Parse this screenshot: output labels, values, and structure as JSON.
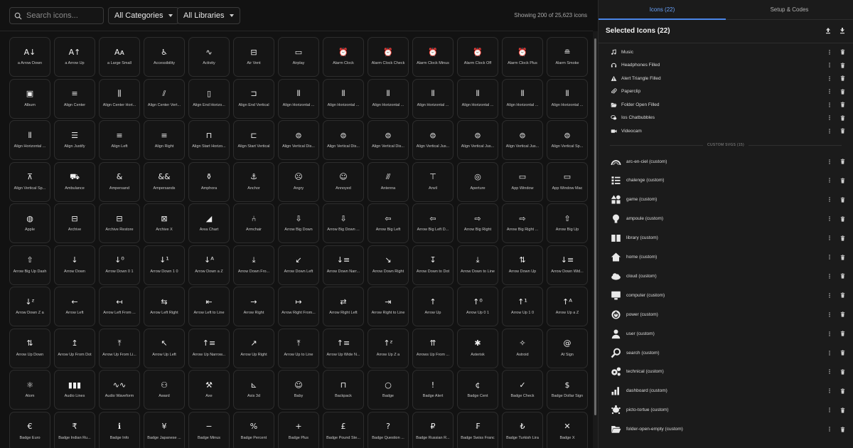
{
  "toolbar": {
    "search_placeholder": "Search icons...",
    "category_select": "All Categories",
    "library_select": "All Libraries",
    "count_text": "Showing 200 of 25,623 icons"
  },
  "icons": [
    {
      "label": "a Arrow Down",
      "glyph": "A↓"
    },
    {
      "label": "a Arrow Up",
      "glyph": "A↑"
    },
    {
      "label": "a Large Small",
      "glyph": "Aᴀ"
    },
    {
      "label": "Accessibility",
      "glyph": "♿"
    },
    {
      "label": "Activity",
      "glyph": "∿"
    },
    {
      "label": "Air Vent",
      "glyph": "⊟"
    },
    {
      "label": "Airplay",
      "glyph": "▭"
    },
    {
      "label": "Alarm Clock",
      "glyph": "⏰"
    },
    {
      "label": "Alarm Clock Check",
      "glyph": "⏰"
    },
    {
      "label": "Alarm Clock Minus",
      "glyph": "⏰"
    },
    {
      "label": "Alarm Clock Off",
      "glyph": "⏰"
    },
    {
      "label": "Alarm Clock Plus",
      "glyph": "⏰"
    },
    {
      "label": "Alarm Smoke",
      "glyph": "≘"
    },
    {
      "label": "Album",
      "glyph": "▣"
    },
    {
      "label": "Align Center",
      "glyph": "≡"
    },
    {
      "label": "Align Center Hori...",
      "glyph": "⫼"
    },
    {
      "label": "Align Center Vert...",
      "glyph": "⫽"
    },
    {
      "label": "Align End Horizo...",
      "glyph": "▯"
    },
    {
      "label": "Align End Vertical",
      "glyph": "⊐"
    },
    {
      "label": "Align Horizontal ...",
      "glyph": "⫴"
    },
    {
      "label": "Align Horizontal ...",
      "glyph": "⫴"
    },
    {
      "label": "Align Horizontal ...",
      "glyph": "⫴"
    },
    {
      "label": "Align Horizontal ...",
      "glyph": "⫴"
    },
    {
      "label": "Align Horizontal ...",
      "glyph": "⫴"
    },
    {
      "label": "Align Horizontal ...",
      "glyph": "⫴"
    },
    {
      "label": "Align Horizontal ...",
      "glyph": "⫴"
    },
    {
      "label": "Align Horizontal ...",
      "glyph": "⫴"
    },
    {
      "label": "Align Justify",
      "glyph": "☰"
    },
    {
      "label": "Align Left",
      "glyph": "≡"
    },
    {
      "label": "Align Right",
      "glyph": "≡"
    },
    {
      "label": "Align Start Horizo...",
      "glyph": "⊓"
    },
    {
      "label": "Align Start Vertical",
      "glyph": "⊏"
    },
    {
      "label": "Align Vertical Dis...",
      "glyph": "⊜"
    },
    {
      "label": "Align Vertical Dis...",
      "glyph": "⊜"
    },
    {
      "label": "Align Vertical Dis...",
      "glyph": "⊜"
    },
    {
      "label": "Align Vertical Jus...",
      "glyph": "⊜"
    },
    {
      "label": "Align Vertical Jus...",
      "glyph": "⊜"
    },
    {
      "label": "Align Vertical Jus...",
      "glyph": "⊜"
    },
    {
      "label": "Align Vertical Sp...",
      "glyph": "⊜"
    },
    {
      "label": "Align Vertical Sp...",
      "glyph": "⊼"
    },
    {
      "label": "Ambulance",
      "glyph": "⛟"
    },
    {
      "label": "Ampersand",
      "glyph": "&"
    },
    {
      "label": "Ampersands",
      "glyph": "&&"
    },
    {
      "label": "Amphora",
      "glyph": "⚱"
    },
    {
      "label": "Anchor",
      "glyph": "⚓"
    },
    {
      "label": "Angry",
      "glyph": "☹"
    },
    {
      "label": "Annoyed",
      "glyph": "☺"
    },
    {
      "label": "Antenna",
      "glyph": "⫻"
    },
    {
      "label": "Anvil",
      "glyph": "⊤"
    },
    {
      "label": "Aperture",
      "glyph": "◎"
    },
    {
      "label": "App Window",
      "glyph": "▭"
    },
    {
      "label": "App Window Mac",
      "glyph": "▭"
    },
    {
      "label": "Apple",
      "glyph": "◍"
    },
    {
      "label": "Archive",
      "glyph": "⊟"
    },
    {
      "label": "Archive Restore",
      "glyph": "⊟"
    },
    {
      "label": "Archive X",
      "glyph": "⊠"
    },
    {
      "label": "Area Chart",
      "glyph": "◢"
    },
    {
      "label": "Armchair",
      "glyph": "⑃"
    },
    {
      "label": "Arrow Big Down",
      "glyph": "⇩"
    },
    {
      "label": "Arrow Big Down ...",
      "glyph": "⇩"
    },
    {
      "label": "Arrow Big Left",
      "glyph": "⇦"
    },
    {
      "label": "Arrow Big Left D...",
      "glyph": "⇦"
    },
    {
      "label": "Arrow Big Right",
      "glyph": "⇨"
    },
    {
      "label": "Arrow Big Right ...",
      "glyph": "⇨"
    },
    {
      "label": "Arrow Big Up",
      "glyph": "⇧"
    },
    {
      "label": "Arrow Big Up Dash",
      "glyph": "⇧"
    },
    {
      "label": "Arrow Down",
      "glyph": "↓"
    },
    {
      "label": "Arrow Down 0 1",
      "glyph": "↓⁰"
    },
    {
      "label": "Arrow Down 1 0",
      "glyph": "↓¹"
    },
    {
      "label": "Arrow Down a Z",
      "glyph": "↓ᴬ"
    },
    {
      "label": "Arrow Down Fro...",
      "glyph": "⤓"
    },
    {
      "label": "Arrow Down Left",
      "glyph": "↙"
    },
    {
      "label": "Arrow Down Narr...",
      "glyph": "↓≡"
    },
    {
      "label": "Arrow Down Right",
      "glyph": "↘"
    },
    {
      "label": "Arrow Down to Dot",
      "glyph": "↧"
    },
    {
      "label": "Arrow Down to Line",
      "glyph": "⤓"
    },
    {
      "label": "Arrow Down Up",
      "glyph": "⇅"
    },
    {
      "label": "Arrow Down Wid...",
      "glyph": "↓≡"
    },
    {
      "label": "Arrow Down Z a",
      "glyph": "↓ᶻ"
    },
    {
      "label": "Arrow Left",
      "glyph": "←"
    },
    {
      "label": "Arrow Left From ...",
      "glyph": "↤"
    },
    {
      "label": "Arrow Left Right",
      "glyph": "⇆"
    },
    {
      "label": "Arrow Left to Line",
      "glyph": "⇤"
    },
    {
      "label": "Arrow Right",
      "glyph": "→"
    },
    {
      "label": "Arrow Right From...",
      "glyph": "↦"
    },
    {
      "label": "Arrow Right Left",
      "glyph": "⇄"
    },
    {
      "label": "Arrow Right to Line",
      "glyph": "⇥"
    },
    {
      "label": "Arrow Up",
      "glyph": "↑"
    },
    {
      "label": "Arrow Up 0 1",
      "glyph": "↑⁰"
    },
    {
      "label": "Arrow Up 1 0",
      "glyph": "↑¹"
    },
    {
      "label": "Arrow Up a Z",
      "glyph": "↑ᴬ"
    },
    {
      "label": "Arrow Up Down",
      "glyph": "⇅"
    },
    {
      "label": "Arrow Up From Dot",
      "glyph": "↥"
    },
    {
      "label": "Arrow Up From Li...",
      "glyph": "⤒"
    },
    {
      "label": "Arrow Up Left",
      "glyph": "↖"
    },
    {
      "label": "Arrow Up Narrow...",
      "glyph": "↑≡"
    },
    {
      "label": "Arrow Up Right",
      "glyph": "↗"
    },
    {
      "label": "Arrow Up to Line",
      "glyph": "⤒"
    },
    {
      "label": "Arrow Up Wide N...",
      "glyph": "↑≡"
    },
    {
      "label": "Arrow Up Z a",
      "glyph": "↑ᶻ"
    },
    {
      "label": "Arrows Up From ...",
      "glyph": "⇈"
    },
    {
      "label": "Asterisk",
      "glyph": "✱"
    },
    {
      "label": "Astroid",
      "glyph": "✧"
    },
    {
      "label": "At Sign",
      "glyph": "@"
    },
    {
      "label": "Atom",
      "glyph": "⚛"
    },
    {
      "label": "Audio Lines",
      "glyph": "▮▮▮"
    },
    {
      "label": "Audio Waveform",
      "glyph": "∿∿"
    },
    {
      "label": "Award",
      "glyph": "⚇"
    },
    {
      "label": "Axe",
      "glyph": "⚒"
    },
    {
      "label": "Axis 3d",
      "glyph": "⊾"
    },
    {
      "label": "Baby",
      "glyph": "☺"
    },
    {
      "label": "Backpack",
      "glyph": "⊓"
    },
    {
      "label": "Badge",
      "glyph": "○"
    },
    {
      "label": "Badge Alert",
      "glyph": "!"
    },
    {
      "label": "Badge Cent",
      "glyph": "¢"
    },
    {
      "label": "Badge Check",
      "glyph": "✓"
    },
    {
      "label": "Badge Dollar Sign",
      "glyph": "$"
    },
    {
      "label": "Badge Euro",
      "glyph": "€"
    },
    {
      "label": "Badge Indian Ru...",
      "glyph": "₹"
    },
    {
      "label": "Badge Info",
      "glyph": "ℹ"
    },
    {
      "label": "Badge Japanese ...",
      "glyph": "¥"
    },
    {
      "label": "Badge Minus",
      "glyph": "−"
    },
    {
      "label": "Badge Percent",
      "glyph": "%"
    },
    {
      "label": "Badge Plus",
      "glyph": "+"
    },
    {
      "label": "Badge Pound Ste...",
      "glyph": "£"
    },
    {
      "label": "Badge Question ...",
      "glyph": "?"
    },
    {
      "label": "Badge Russian R...",
      "glyph": "₽"
    },
    {
      "label": "Badge Swiss Franc",
      "glyph": "₣"
    },
    {
      "label": "Badge Turkish Lira",
      "glyph": "₺"
    },
    {
      "label": "Badge X",
      "glyph": "✕"
    }
  ],
  "panel": {
    "tab_icons": "Icons (22)",
    "tab_setup": "Setup & Codes",
    "heading": "Selected Icons (22)",
    "custom_divider": "CUSTOM SVGS (15)",
    "selected": [
      {
        "label": "Music",
        "icon": "music-icon"
      },
      {
        "label": "Headphones Filled",
        "icon": "headphones-icon"
      },
      {
        "label": "Alert Triangle Filled",
        "icon": "alert-triangle-icon"
      },
      {
        "label": "Paperclip",
        "icon": "paperclip-icon"
      },
      {
        "label": "Folder Open Filled",
        "icon": "folder-open-icon"
      },
      {
        "label": "Ios Chatbubbles",
        "icon": "chatbubbles-icon"
      },
      {
        "label": "Videocam",
        "icon": "videocam-icon"
      }
    ],
    "custom": [
      {
        "label": "arc-en-ciel (custom)",
        "icon": "rainbow-icon"
      },
      {
        "label": "chalenge (custom)",
        "icon": "list-icon"
      },
      {
        "label": "game (custom)",
        "icon": "shapes-icon"
      },
      {
        "label": "ampoule (custom)",
        "icon": "bulb-icon"
      },
      {
        "label": "library (custom)",
        "icon": "book-icon"
      },
      {
        "label": "home (custom)",
        "icon": "home-icon"
      },
      {
        "label": "cloud (custom)",
        "icon": "cloud-icon"
      },
      {
        "label": "computer (custom)",
        "icon": "computer-icon"
      },
      {
        "label": "power (custom)",
        "icon": "power-icon"
      },
      {
        "label": "user (custom)",
        "icon": "user-icon"
      },
      {
        "label": "search (custom)",
        "icon": "search-icon"
      },
      {
        "label": "technical (custom)",
        "icon": "gears-icon"
      },
      {
        "label": "dashboard (custom)",
        "icon": "bars-icon"
      },
      {
        "label": "picto-tortue (custom)",
        "icon": "turtle-icon"
      },
      {
        "label": "folder-open-empty (custom)",
        "icon": "folder-open-icon"
      }
    ]
  },
  "colors": {
    "background": "#121212",
    "panel": "#1b1b1b",
    "accent": "#4a86e8"
  }
}
